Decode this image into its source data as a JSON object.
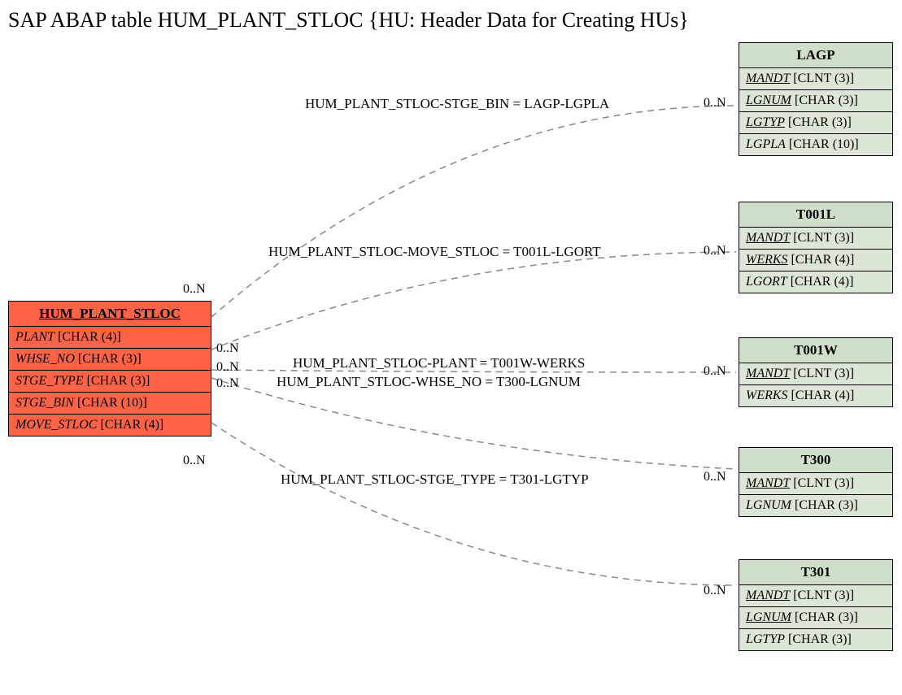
{
  "title": "SAP ABAP table HUM_PLANT_STLOC {HU: Header Data for Creating HUs}",
  "main": {
    "name": "HUM_PLANT_STLOC",
    "fields": [
      {
        "name": "PLANT",
        "type": "[CHAR (4)]",
        "u": false
      },
      {
        "name": "WHSE_NO",
        "type": "[CHAR (3)]",
        "u": false
      },
      {
        "name": "STGE_TYPE",
        "type": "[CHAR (3)]",
        "u": false
      },
      {
        "name": "STGE_BIN",
        "type": "[CHAR (10)]",
        "u": false
      },
      {
        "name": "MOVE_STLOC",
        "type": "[CHAR (4)]",
        "u": false
      }
    ]
  },
  "subs": {
    "lagp": {
      "name": "LAGP",
      "fields": [
        {
          "name": "MANDT",
          "type": "[CLNT (3)]",
          "u": true
        },
        {
          "name": "LGNUM",
          "type": "[CHAR (3)]",
          "u": true
        },
        {
          "name": "LGTYP",
          "type": "[CHAR (3)]",
          "u": true
        },
        {
          "name": "LGPLA",
          "type": "[CHAR (10)]",
          "u": false
        }
      ]
    },
    "t001l": {
      "name": "T001L",
      "fields": [
        {
          "name": "MANDT",
          "type": "[CLNT (3)]",
          "u": true
        },
        {
          "name": "WERKS",
          "type": "[CHAR (4)]",
          "u": true
        },
        {
          "name": "LGORT",
          "type": "[CHAR (4)]",
          "u": false
        }
      ]
    },
    "t001w": {
      "name": "T001W",
      "fields": [
        {
          "name": "MANDT",
          "type": "[CLNT (3)]",
          "u": true
        },
        {
          "name": "WERKS",
          "type": "[CHAR (4)]",
          "u": false
        }
      ]
    },
    "t300": {
      "name": "T300",
      "fields": [
        {
          "name": "MANDT",
          "type": "[CLNT (3)]",
          "u": true
        },
        {
          "name": "LGNUM",
          "type": "[CHAR (3)]",
          "u": false
        }
      ]
    },
    "t301": {
      "name": "T301",
      "fields": [
        {
          "name": "MANDT",
          "type": "[CLNT (3)]",
          "u": true
        },
        {
          "name": "LGNUM",
          "type": "[CHAR (3)]",
          "u": true
        },
        {
          "name": "LGTYP",
          "type": "[CHAR (3)]",
          "u": false
        }
      ]
    }
  },
  "rels": {
    "r1": "HUM_PLANT_STLOC-STGE_BIN = LAGP-LGPLA",
    "r2": "HUM_PLANT_STLOC-MOVE_STLOC = T001L-LGORT",
    "r3": "HUM_PLANT_STLOC-PLANT = T001W-WERKS",
    "r4": "HUM_PLANT_STLOC-WHSE_NO = T300-LGNUM",
    "r5": "HUM_PLANT_STLOC-STGE_TYPE = T301-LGTYP"
  },
  "card": "0..N"
}
